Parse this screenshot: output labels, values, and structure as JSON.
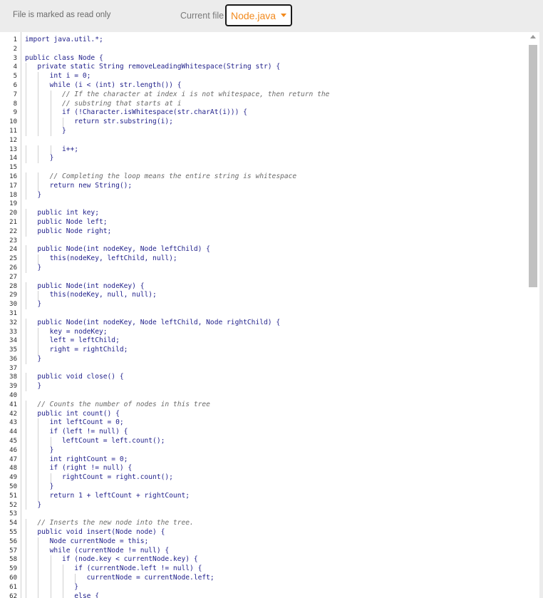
{
  "header": {
    "read_only_notice": "File is marked as read only",
    "current_file_label": "Current file",
    "current_file_value": "Node.java"
  },
  "code": {
    "lines": [
      "import java.util.*;",
      "",
      "public class Node {",
      "   private static String removeLeadingWhitespace(String str) {",
      "      int i = 0;",
      "      while (i < (int) str.length()) {",
      "         // If the character at index i is not whitespace, then return the",
      "         // substring that starts at i",
      "         if (!Character.isWhitespace(str.charAt(i))) {",
      "            return str.substring(i);",
      "         }",
      "",
      "         i++;",
      "      }",
      "",
      "      // Completing the loop means the entire string is whitespace",
      "      return new String();",
      "   }",
      "",
      "   public int key;",
      "   public Node left;",
      "   public Node right;",
      "",
      "   public Node(int nodeKey, Node leftChild) {",
      "      this(nodeKey, leftChild, null);",
      "   }",
      "",
      "   public Node(int nodeKey) {",
      "      this(nodeKey, null, null);",
      "   }",
      "",
      "   public Node(int nodeKey, Node leftChild, Node rightChild) {",
      "      key = nodeKey;",
      "      left = leftChild;",
      "      right = rightChild;",
      "   }",
      "",
      "   public void close() {",
      "   }",
      "",
      "   // Counts the number of nodes in this tree",
      "   public int count() {",
      "      int leftCount = 0;",
      "      if (left != null) {",
      "         leftCount = left.count();",
      "      }",
      "      int rightCount = 0;",
      "      if (right != null) {",
      "         rightCount = right.count();",
      "      }",
      "      return 1 + leftCount + rightCount;",
      "   }",
      "",
      "   // Inserts the new node into the tree.",
      "   public void insert(Node node) {",
      "      Node currentNode = this;",
      "      while (currentNode != null) {",
      "         if (node.key < currentNode.key) {",
      "            if (currentNode.left != null) {",
      "               currentNode = currentNode.left;",
      "            }",
      "            else {"
    ]
  }
}
